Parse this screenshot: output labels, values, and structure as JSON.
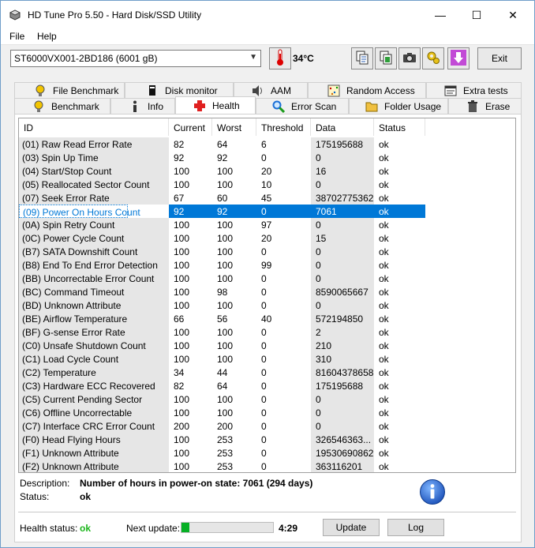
{
  "window": {
    "title": "HD Tune Pro 5.50 - Hard Disk/SSD Utility",
    "minimize_glyph": "—",
    "maximize_glyph": "☐",
    "close_glyph": "✕"
  },
  "menu": {
    "file": "File",
    "help": "Help"
  },
  "toolbar": {
    "drive": "ST6000VX001-2BD186 (6001 gB)",
    "temperature": "34°C",
    "exit_label": "Exit",
    "icons": [
      "thermometer-icon",
      "copy-text-icon",
      "copy-image-icon",
      "screenshot-icon",
      "options-icon",
      "save-icon"
    ]
  },
  "tabs": {
    "row1": [
      "File Benchmark",
      "Disk monitor",
      "AAM",
      "Random Access",
      "Extra tests"
    ],
    "row2": [
      "Benchmark",
      "Info",
      "Health",
      "Error Scan",
      "Folder Usage",
      "Erase"
    ],
    "active": "Health"
  },
  "table": {
    "columns": [
      "ID",
      "Current",
      "Worst",
      "Threshold",
      "Data",
      "Status"
    ],
    "selected_index": 5,
    "rows": [
      [
        "(01) Raw Read Error Rate",
        "82",
        "64",
        "6",
        "175195688",
        "ok"
      ],
      [
        "(03) Spin Up Time",
        "92",
        "92",
        "0",
        "0",
        "ok"
      ],
      [
        "(04) Start/Stop Count",
        "100",
        "100",
        "20",
        "16",
        "ok"
      ],
      [
        "(05) Reallocated Sector Count",
        "100",
        "100",
        "10",
        "0",
        "ok"
      ],
      [
        "(07) Seek Error Rate",
        "67",
        "60",
        "45",
        "38702775362",
        "ok"
      ],
      [
        "(09) Power On Hours Count",
        "92",
        "92",
        "0",
        "7061",
        "ok"
      ],
      [
        "(0A) Spin Retry Count",
        "100",
        "100",
        "97",
        "0",
        "ok"
      ],
      [
        "(0C) Power Cycle Count",
        "100",
        "100",
        "20",
        "15",
        "ok"
      ],
      [
        "(B7) SATA Downshift Count",
        "100",
        "100",
        "0",
        "0",
        "ok"
      ],
      [
        "(B8) End To End Error Detection",
        "100",
        "100",
        "99",
        "0",
        "ok"
      ],
      [
        "(BB) Uncorrectable Error Count",
        "100",
        "100",
        "0",
        "0",
        "ok"
      ],
      [
        "(BC) Command Timeout",
        "100",
        "98",
        "0",
        "8590065667",
        "ok"
      ],
      [
        "(BD) Unknown Attribute",
        "100",
        "100",
        "0",
        "0",
        "ok"
      ],
      [
        "(BE) Airflow Temperature",
        "66",
        "56",
        "40",
        "572194850",
        "ok"
      ],
      [
        "(BF) G-sense Error Rate",
        "100",
        "100",
        "0",
        "2",
        "ok"
      ],
      [
        "(C0) Unsafe Shutdown Count",
        "100",
        "100",
        "0",
        "210",
        "ok"
      ],
      [
        "(C1) Load Cycle Count",
        "100",
        "100",
        "0",
        "310",
        "ok"
      ],
      [
        "(C2) Temperature",
        "34",
        "44",
        "0",
        "81604378658",
        "ok"
      ],
      [
        "(C3) Hardware ECC Recovered",
        "82",
        "64",
        "0",
        "175195688",
        "ok"
      ],
      [
        "(C5) Current Pending Sector",
        "100",
        "100",
        "0",
        "0",
        "ok"
      ],
      [
        "(C6) Offline Uncorrectable",
        "100",
        "100",
        "0",
        "0",
        "ok"
      ],
      [
        "(C7) Interface CRC Error Count",
        "200",
        "200",
        "0",
        "0",
        "ok"
      ],
      [
        "(F0) Head Flying Hours",
        "100",
        "253",
        "0",
        "326546363...",
        "ok"
      ],
      [
        "(F1) Unknown Attribute",
        "100",
        "253",
        "0",
        "19530690862",
        "ok"
      ],
      [
        "(F2) Unknown Attribute",
        "100",
        "253",
        "0",
        "363116201",
        "ok"
      ]
    ]
  },
  "details": {
    "description_label": "Description:",
    "description_value": "Number of hours in power-on state: 7061 (294 days)",
    "status_label": "Status:",
    "status_value": "ok"
  },
  "footer": {
    "health_label": "Health status:",
    "health_value": "ok",
    "next_update_label": "Next update:",
    "next_update_progress": 0.09,
    "next_update_time": "4:29",
    "update_button": "Update",
    "log_button": "Log"
  },
  "colors": {
    "selection": "#0078d7",
    "ok_green": "#1bb51b",
    "progress_green": "#06b025",
    "info_blue": "#1a6fd6"
  }
}
